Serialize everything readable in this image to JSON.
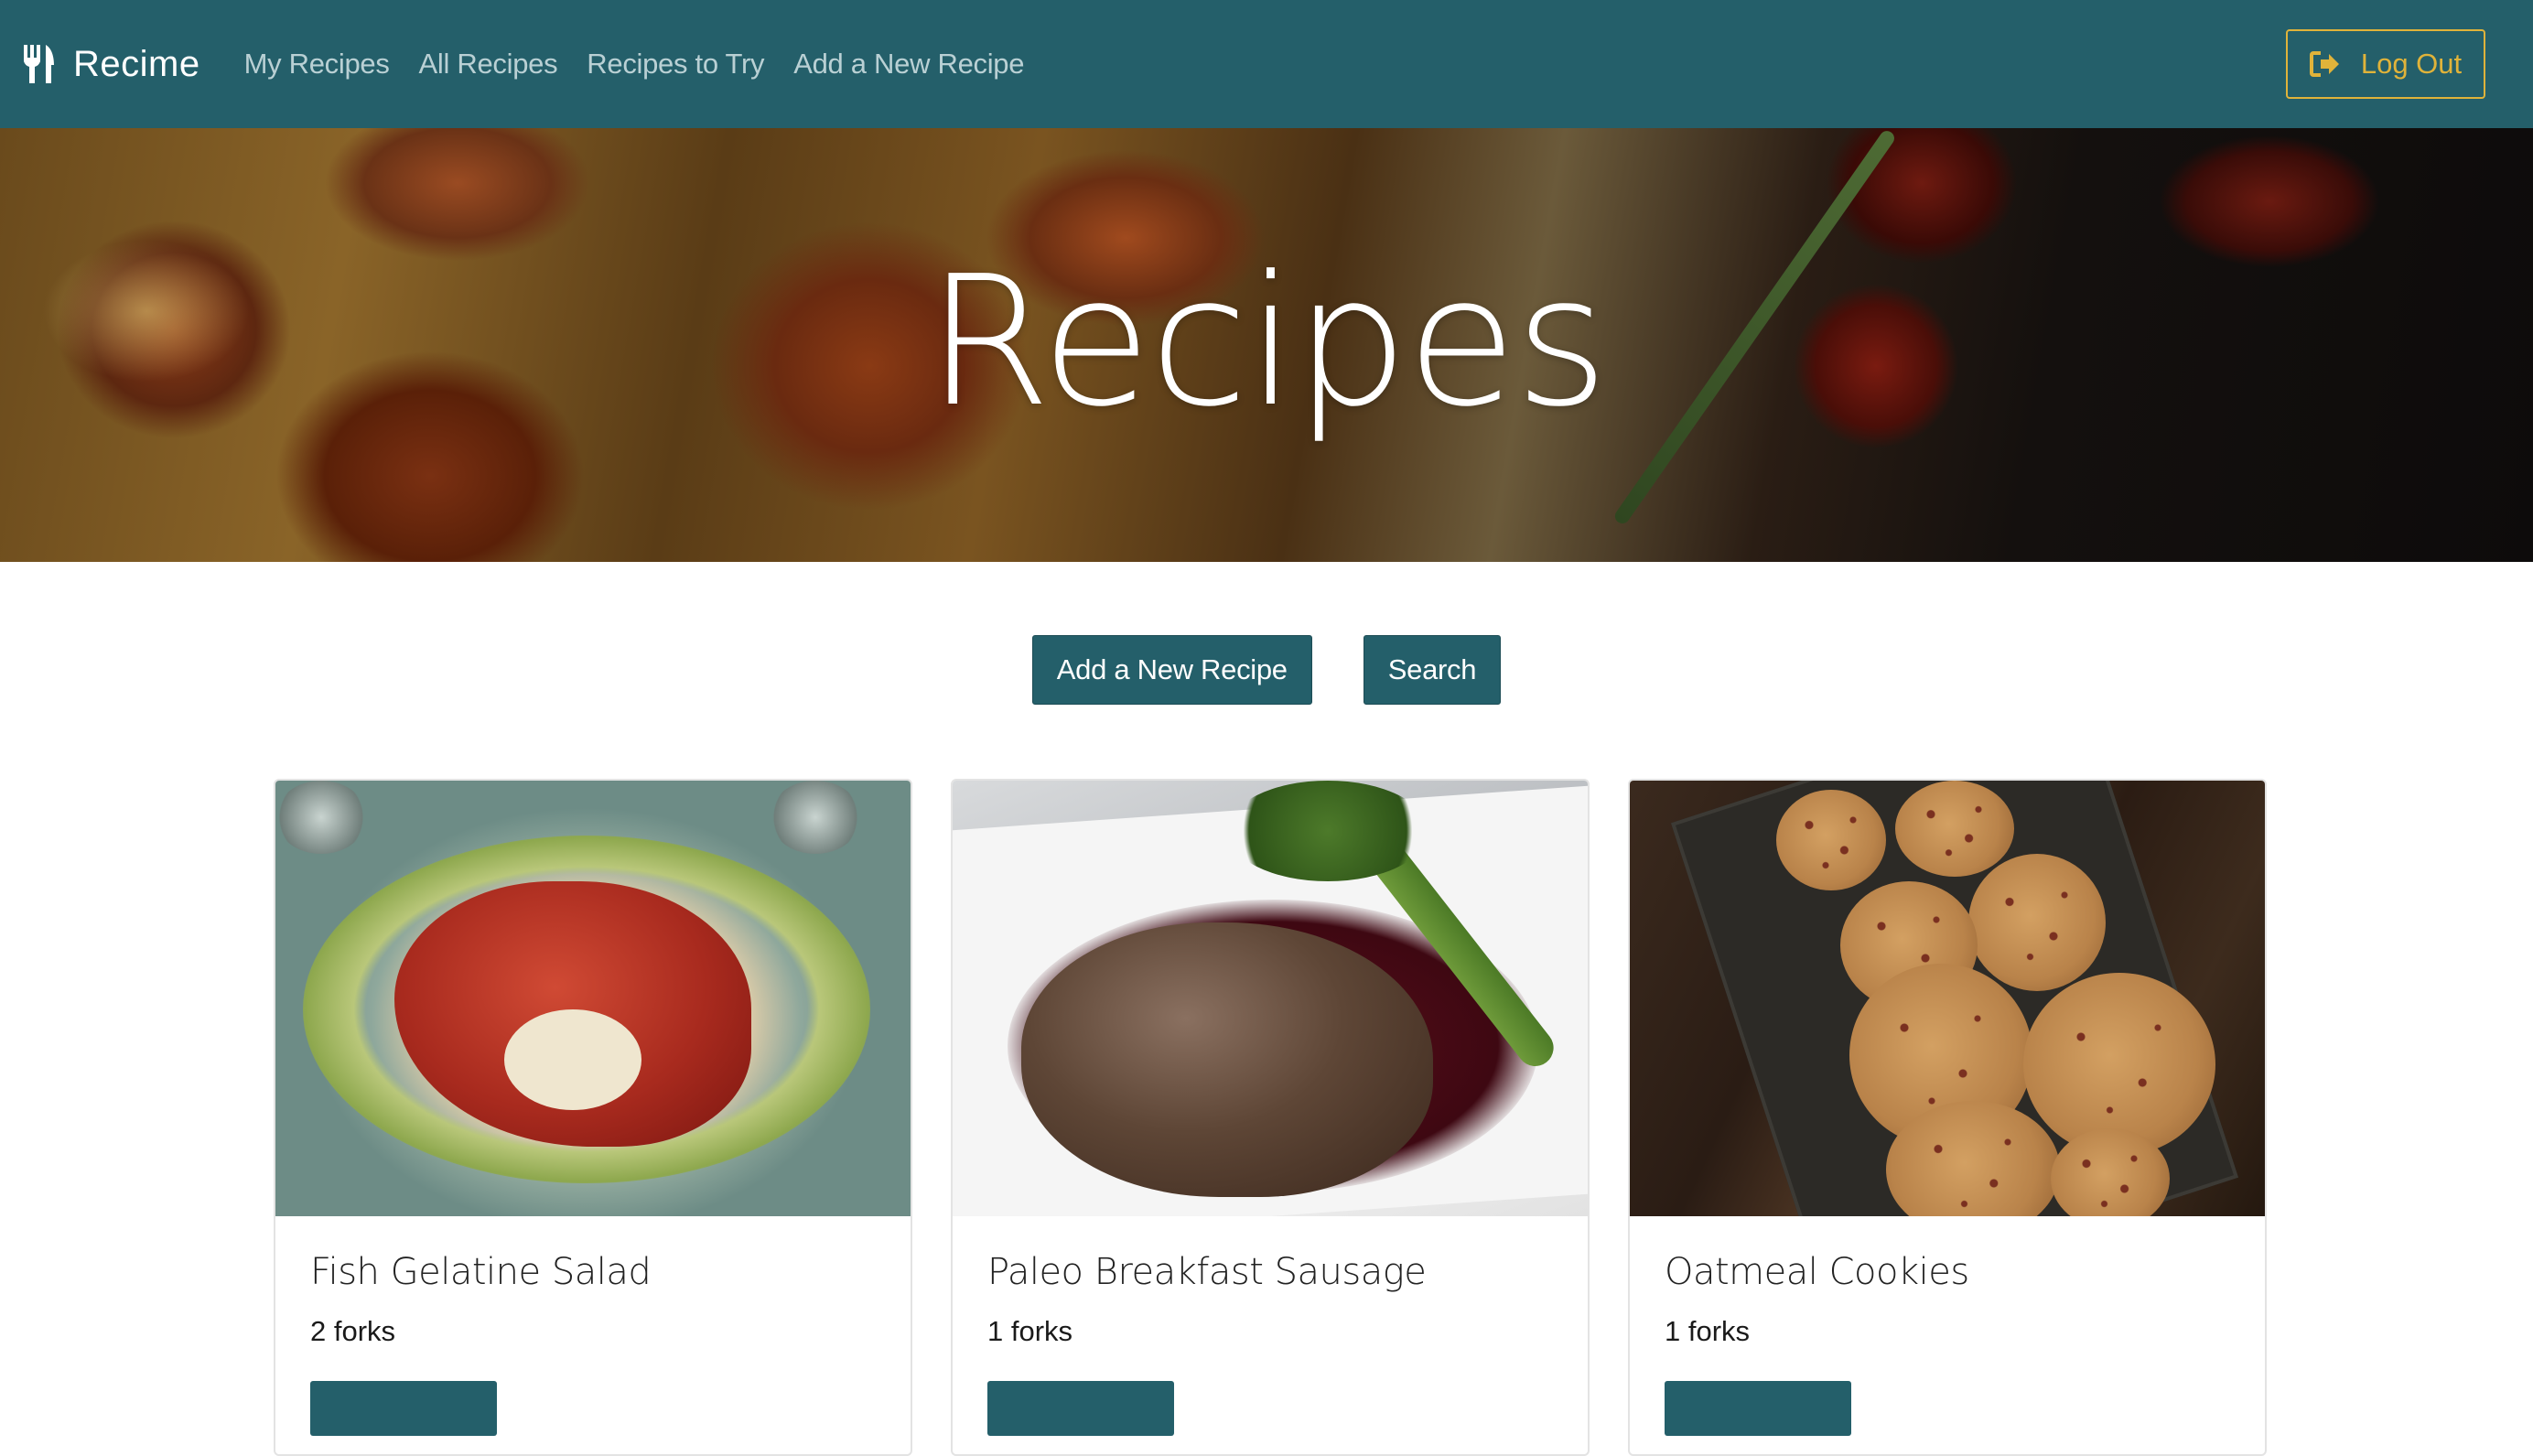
{
  "brand": {
    "name": "Recime",
    "icon": "fork-knife-icon"
  },
  "nav": {
    "links": [
      "My Recipes",
      "All Recipes",
      "Recipes to Try",
      "Add a New Recipe"
    ],
    "logout_label": "Log Out",
    "logout_icon": "sign-out-icon"
  },
  "hero": {
    "title": "Recipes"
  },
  "actions": {
    "add_label": "Add a New Recipe",
    "search_label": "Search"
  },
  "recipes": [
    {
      "title": "Fish Gelatine Salad",
      "rating": "2 forks"
    },
    {
      "title": "Paleo Breakfast Sausage",
      "rating": "1 forks"
    },
    {
      "title": "Oatmeal Cookies",
      "rating": "1 forks"
    }
  ],
  "colors": {
    "navbar": "#245f6a",
    "accent": "#e0b33a",
    "nav_link": "#b9d0d4",
    "button": "#245f6a"
  }
}
